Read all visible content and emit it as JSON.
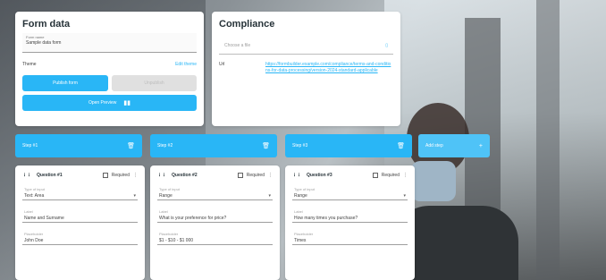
{
  "form": {
    "title": "Form data",
    "name_label": "Form name",
    "name_value": "Sample data form",
    "theme_label": "Theme",
    "theme_link": "Edit theme",
    "btn_publish": "Publish form",
    "btn_disabled": "Unpublish",
    "btn_preview": "Open Preview"
  },
  "compliance": {
    "title": "Compliance",
    "select_placeholder": "Choose a file",
    "url_label": "Url",
    "url_value": "https://formbuilder.example.com/compliance/terms-and-conditions-for-data-processing/version-2024-standard-applicable"
  },
  "steps": [
    {
      "label": "Step #1"
    },
    {
      "label": "Step #2"
    },
    {
      "label": "Step #3"
    }
  ],
  "add_step": "Add step",
  "questions": [
    {
      "title": "Question #1",
      "required": "Required",
      "type_label": "Type of input",
      "type_value": "Text: Area",
      "label_label": "Label",
      "label_value": "Name and Surname",
      "placeholder_label": "Placeholder",
      "placeholder_value": "John Doe"
    },
    {
      "title": "Question #2",
      "required": "Required",
      "type_label": "Type of input",
      "type_value": "Range",
      "label_label": "Label",
      "label_value": "What is your preference for price?",
      "placeholder_label": "Placeholder",
      "placeholder_value": "$1 - $10 - $1 000"
    },
    {
      "title": "Question #3",
      "required": "Required",
      "type_label": "Type of input",
      "type_value": "Range",
      "label_label": "Label",
      "label_value": "How many times you purchase?",
      "placeholder_label": "Placeholder",
      "placeholder_value": "Times"
    }
  ],
  "colors": {
    "accent": "#29b6f6",
    "accent_light": "#4fc3f7",
    "text": "#263238"
  }
}
